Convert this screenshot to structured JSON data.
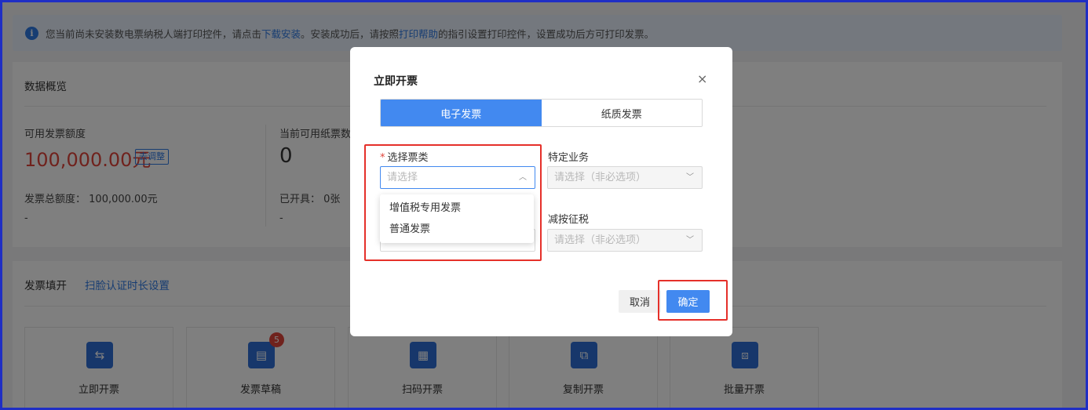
{
  "notice": {
    "text_before": "您当前尚未安装数电票纳税人端打印控件，请点击",
    "download_link": "下载安装",
    "text_middle": "。安装成功后，请按照",
    "help_link": "打印帮助",
    "text_after": "的指引设置打印控件，设置成功后方可打印发票。"
  },
  "overview": {
    "title": "数据概览",
    "available_quota_label": "可用发票额度",
    "available_quota_value": "100,000.00元",
    "adjust_button": "去调整",
    "total_quota_label": "发票总额度：",
    "total_quota_value": "100,000.00元",
    "dash1": "-",
    "paper_label": "当前可用纸票数",
    "paper_value": "0",
    "issued_label": "已开具：",
    "issued_value": "0张",
    "dash2": "-"
  },
  "fill": {
    "title": "发票填开",
    "link": "扫脸认证时长设置",
    "tiles": [
      {
        "label": "立即开票",
        "icon": "invoice-icon"
      },
      {
        "label": "发票草稿",
        "icon": "draft-icon",
        "badge": "5"
      },
      {
        "label": "扫码开票",
        "icon": "qr-code-icon"
      },
      {
        "label": "复制开票",
        "icon": "copy-invoice-icon"
      },
      {
        "label": "批量开票",
        "icon": "batch-invoice-icon"
      }
    ]
  },
  "modal": {
    "title": "立即开票",
    "close": "×",
    "tabs": [
      "电子发票",
      "纸质发票"
    ],
    "ticket_type_label": "选择票类",
    "ticket_type_placeholder": "请选择",
    "business_label": "特定业务",
    "business_placeholder": "请选择（非必选项）",
    "tax_label": "减按征税",
    "tax_placeholder": "请选择（非必选项）",
    "options": [
      "增值税专用发票",
      "普通发票"
    ],
    "cancel": "取消",
    "confirm": "确定"
  },
  "colors": {
    "accent": "#4289f0",
    "highlight_box": "#e5302a",
    "quota_red": "#e0443b"
  }
}
